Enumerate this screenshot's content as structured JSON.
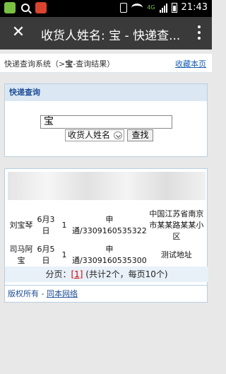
{
  "status": {
    "time": "21:43",
    "network": "4G"
  },
  "appbar": {
    "title": "收货人姓名: 宝 - 快递查..."
  },
  "breadcrumb": {
    "system": "快递查询系统",
    "current": "宝",
    "result": "查询结果",
    "favorite_label": "收藏本页"
  },
  "search": {
    "header": "快递查询",
    "query": "宝",
    "field_selected": "收货人姓名",
    "button_label": "查找"
  },
  "results": {
    "rows": [
      {
        "name": "刘宝琴",
        "date": "6月3日",
        "count": "1",
        "tracking": "申通/3309160535322",
        "address": "中国江苏省南京市某某路某某小区"
      },
      {
        "name": "司马阿宝",
        "date": "6月5日",
        "count": "1",
        "tracking": "申通/3309160535300",
        "address": "测试地址"
      }
    ],
    "pager_prefix": "分页：",
    "current_page": "[1]",
    "pager_summary": "(共计2个，每页10个)"
  },
  "footer": {
    "prefix": "版权所有 - ",
    "link": "同本网络"
  }
}
